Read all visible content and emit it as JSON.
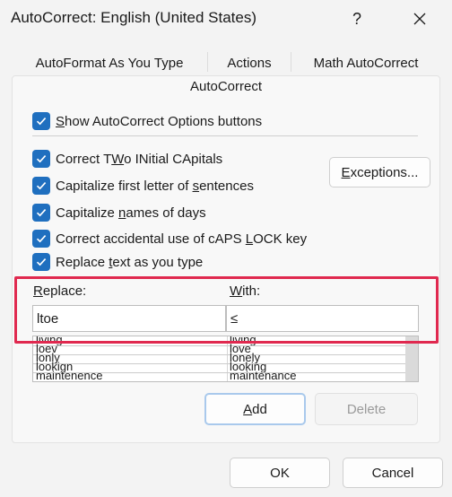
{
  "window": {
    "title": "AutoCorrect: English (United States)",
    "help_glyph": "?",
    "close_icon": "close-icon"
  },
  "tabs": [
    {
      "label": "AutoFormat As You Type"
    },
    {
      "label": "Actions"
    },
    {
      "label": "Math AutoCorrect"
    }
  ],
  "active_tab": {
    "label": "AutoCorrect"
  },
  "options": [
    {
      "pre": "",
      "u": "S",
      "post": "how AutoCorrect Options buttons",
      "checked": true
    },
    {
      "pre": "Correct T",
      "u": "W",
      "post": "o INitial CApitals",
      "checked": true
    },
    {
      "pre": "Capitalize first letter of ",
      "u": "s",
      "post": "entences",
      "checked": true
    },
    {
      "pre": "Capitalize ",
      "u": "n",
      "post": "ames of days",
      "checked": true
    },
    {
      "pre": "Correct accidental use of cAPS ",
      "u": "L",
      "post": "OCK key",
      "checked": true
    },
    {
      "pre": "Replace ",
      "u": "t",
      "post": "ext as you type",
      "checked": true
    }
  ],
  "exceptions_button": {
    "pre": "",
    "u": "E",
    "post": "xceptions..."
  },
  "replace": {
    "label_u": "R",
    "label_post": "eplace:",
    "value": "ltoe"
  },
  "with": {
    "label_u": "W",
    "label_post": "ith:",
    "value": "≤"
  },
  "entries": [
    {
      "replace": "living",
      "with": "living"
    },
    {
      "replace": "loev",
      "with": "love"
    },
    {
      "replace": "lonly",
      "with": "lonely"
    },
    {
      "replace": "lookign",
      "with": "looking"
    },
    {
      "replace": "maintenence",
      "with": "maintenance"
    }
  ],
  "add_button": {
    "u": "A",
    "post": "dd"
  },
  "delete_button": {
    "label": "Delete"
  },
  "ok_button": {
    "label": "OK"
  },
  "cancel_button": {
    "label": "Cancel"
  },
  "colors": {
    "checkbox": "#1f6fbf",
    "highlight": "#e0294f"
  }
}
